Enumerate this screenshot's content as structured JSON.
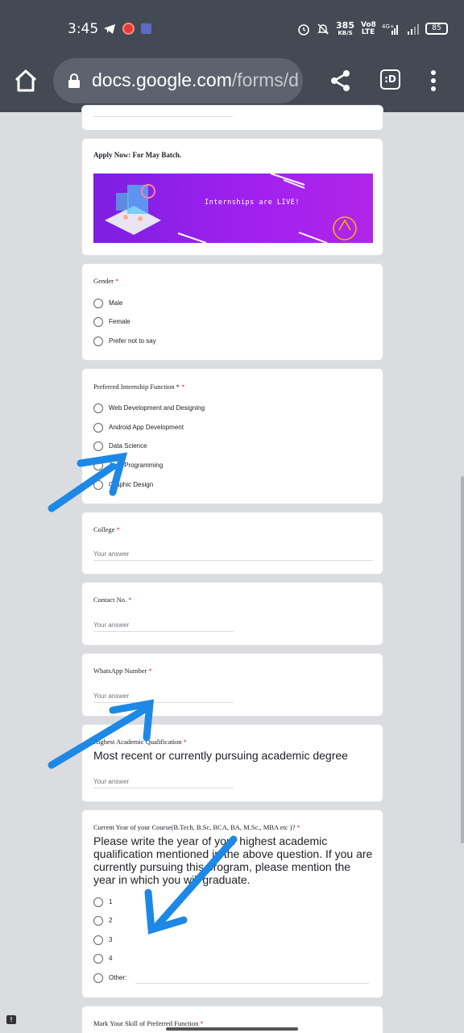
{
  "status_bar": {
    "time": "3:45",
    "net_speed": "385",
    "net_unit": "KB/S",
    "volte": "Vo8\nLTE",
    "network": "4G+",
    "battery": "85"
  },
  "browser": {
    "url_host": "docs.google.com",
    "url_path": "/forms/d",
    "tabs_label": ":D"
  },
  "form": {
    "apply_title": "Apply Now: For May Batch.",
    "banner_text": "Internships are LIVE!",
    "gender": {
      "title": "Gender",
      "options": [
        "Male",
        "Female",
        "Prefer not to say"
      ]
    },
    "internship_function": {
      "title": "Preferred Internship Function *",
      "options": [
        "Web Development and Designing",
        "Android App Development",
        "Data Science",
        "Java Programming",
        "Graphic Design"
      ]
    },
    "college": {
      "title": "College",
      "placeholder": "Your answer"
    },
    "contact": {
      "title": "Contact No.",
      "placeholder": "Your answer"
    },
    "whatsapp": {
      "title": "WhatsApp Number",
      "placeholder": "Your answer"
    },
    "qualification": {
      "title": "Highest Academic Qualification",
      "description": "Most recent or currently pursuing academic degree",
      "placeholder": "Your answer"
    },
    "current_year": {
      "title": "Current Year of your Course(B.Tech, B.Sc, BCA, BA, M.Sc., MBA etc )?",
      "description": "Please write the year of your highest academic qualification mentioned in the above question. If you are currently pursuing this program, please mention the year in which you will graduate.",
      "options": [
        "1",
        "2",
        "3",
        "4",
        "Other:"
      ]
    },
    "skill": {
      "title": "Mark Your Skill of Preferred Function"
    }
  },
  "colors": {
    "toolbar": "#434a54",
    "required": "#d93025",
    "annotation_arrow": "#1e88e5",
    "banner": "#a020f0"
  }
}
